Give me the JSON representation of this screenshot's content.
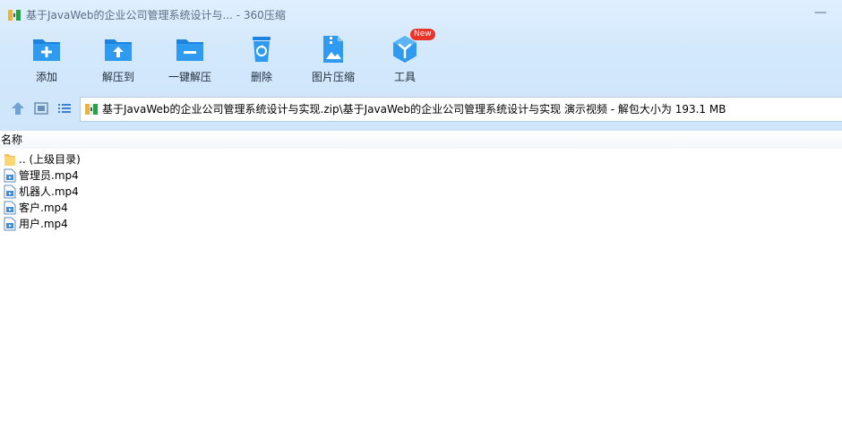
{
  "window": {
    "title": "基于JavaWeb的企业公司管理系统设计与... - 360压缩",
    "minimize_glyph": "—"
  },
  "toolbar": {
    "items": [
      {
        "label": "添加",
        "icon": "folder-add-icon"
      },
      {
        "label": "解压到",
        "icon": "folder-extract-icon"
      },
      {
        "label": "一键解压",
        "icon": "folder-minus-icon"
      },
      {
        "label": "删除",
        "icon": "recycle-bin-icon"
      },
      {
        "label": "图片压缩",
        "icon": "image-compress-icon"
      },
      {
        "label": "工具",
        "icon": "tools-cube-icon",
        "badge": "New"
      }
    ]
  },
  "nav": {
    "path": "基于JavaWeb的企业公司管理系统设计与实现.zip\\基于JavaWeb的企业公司管理系统设计与实现 演示视频 - 解包大小为 193.1 MB"
  },
  "list": {
    "column_name": "名称",
    "rows": [
      {
        "name": ".. (上级目录)",
        "type": "folder"
      },
      {
        "name": "管理员.mp4",
        "type": "video"
      },
      {
        "name": "机器人.mp4",
        "type": "video"
      },
      {
        "name": "客户.mp4",
        "type": "video"
      },
      {
        "name": "用户.mp4",
        "type": "video"
      }
    ]
  },
  "colors": {
    "accent": "#1e8fe6",
    "toolbar_bg": "#d3e8fb",
    "badge": "#e9342b"
  }
}
